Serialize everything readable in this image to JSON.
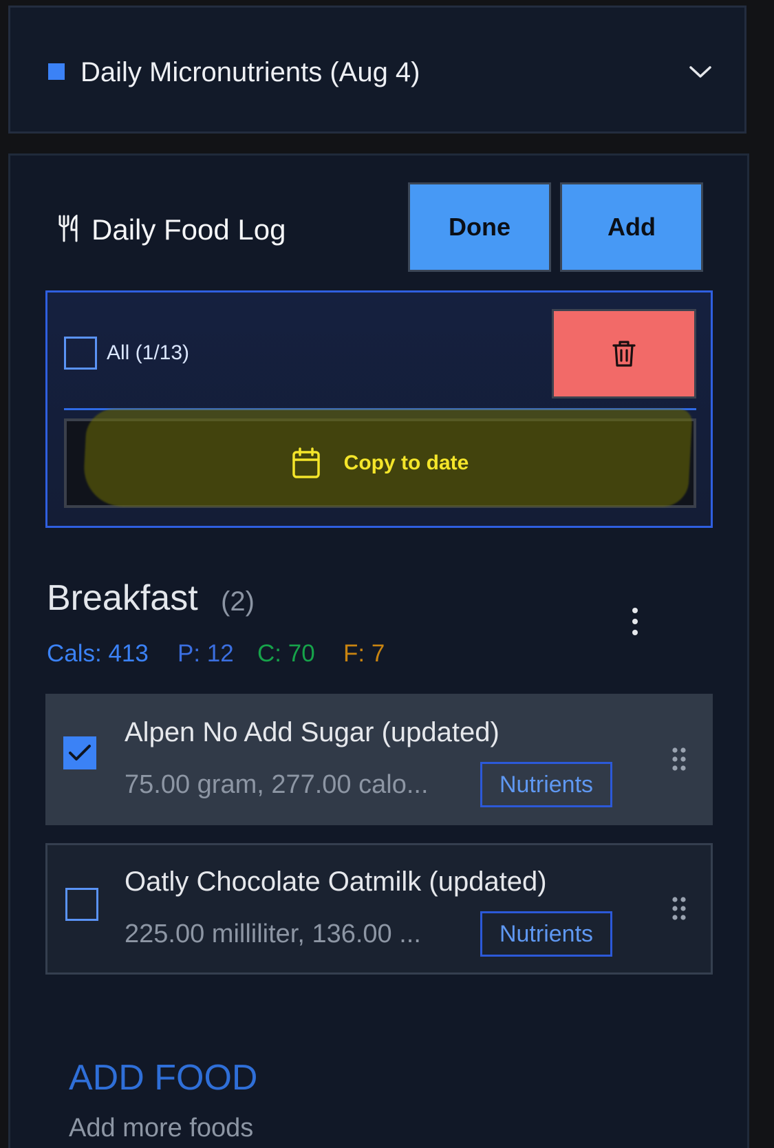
{
  "micronutrients": {
    "title": "Daily Micronutrients (Aug 4)",
    "accent_color": "#3b82f6",
    "expand_icon": "chevron-down-icon"
  },
  "food_log": {
    "title": "Daily Food Log",
    "icon": "utensils-icon",
    "done_label": "Done",
    "add_label": "Add"
  },
  "selection": {
    "all_label": "All (1/13)",
    "all_checked": false,
    "delete_icon": "trash-icon",
    "copy_label": "Copy to date",
    "copy_icon": "calendar-icon"
  },
  "meal": {
    "name": "Breakfast",
    "count": "(2)",
    "menu_icon": "more-vertical-icon",
    "macros": {
      "cals": "Cals: 413",
      "protein": "P: 12",
      "carbs": "C: 70",
      "fat": "F: 7"
    },
    "items": [
      {
        "name": "Alpen No Add Sugar (updated)",
        "detail": "75.00 gram, 277.00 calo...",
        "nutrients_label": "Nutrients",
        "checked": true
      },
      {
        "name": "Oatly Chocolate Oatmilk (updated)",
        "detail": "225.00 milliliter, 136.00 ...",
        "nutrients_label": "Nutrients",
        "checked": false
      }
    ]
  },
  "add_food": {
    "label": "ADD FOOD",
    "subtitle": "Add more foods"
  },
  "colors": {
    "primary_button": "#4799f5",
    "danger_button": "#f26a68",
    "copy_text": "#f4e52a",
    "cals": "#3b82f6",
    "protein": "#3b6fe0",
    "carbs": "#16a34a",
    "fat": "#c98410"
  }
}
